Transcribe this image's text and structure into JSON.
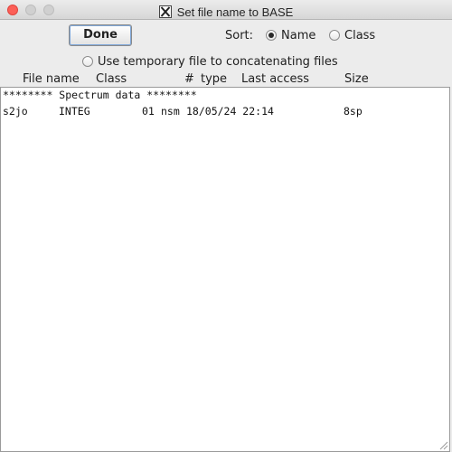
{
  "window": {
    "title": "Set file name to BASE"
  },
  "toolbar": {
    "done_label": "Done",
    "sort_label": "Sort:",
    "sort_options": [
      {
        "label": "Name",
        "selected": true
      },
      {
        "label": "Class",
        "selected": false
      }
    ],
    "temp_file_option": {
      "label": "Use temporary file to concatenating files",
      "selected": false
    }
  },
  "columns": {
    "file_name": "File name",
    "class": "Class",
    "number": "#",
    "type": "type",
    "last_access": "Last access",
    "size": "Size"
  },
  "file_list": {
    "section_header": "******** Spectrum data ********",
    "rows": [
      {
        "file_name": "s2jo",
        "class": "INTEG",
        "number": "01",
        "type": "nsm",
        "last_access": "18/05/24 22:14",
        "size": "8sp"
      }
    ]
  },
  "colors": {
    "close_button": "#fc5f57",
    "background": "#ececec",
    "list_background": "#ffffff"
  }
}
